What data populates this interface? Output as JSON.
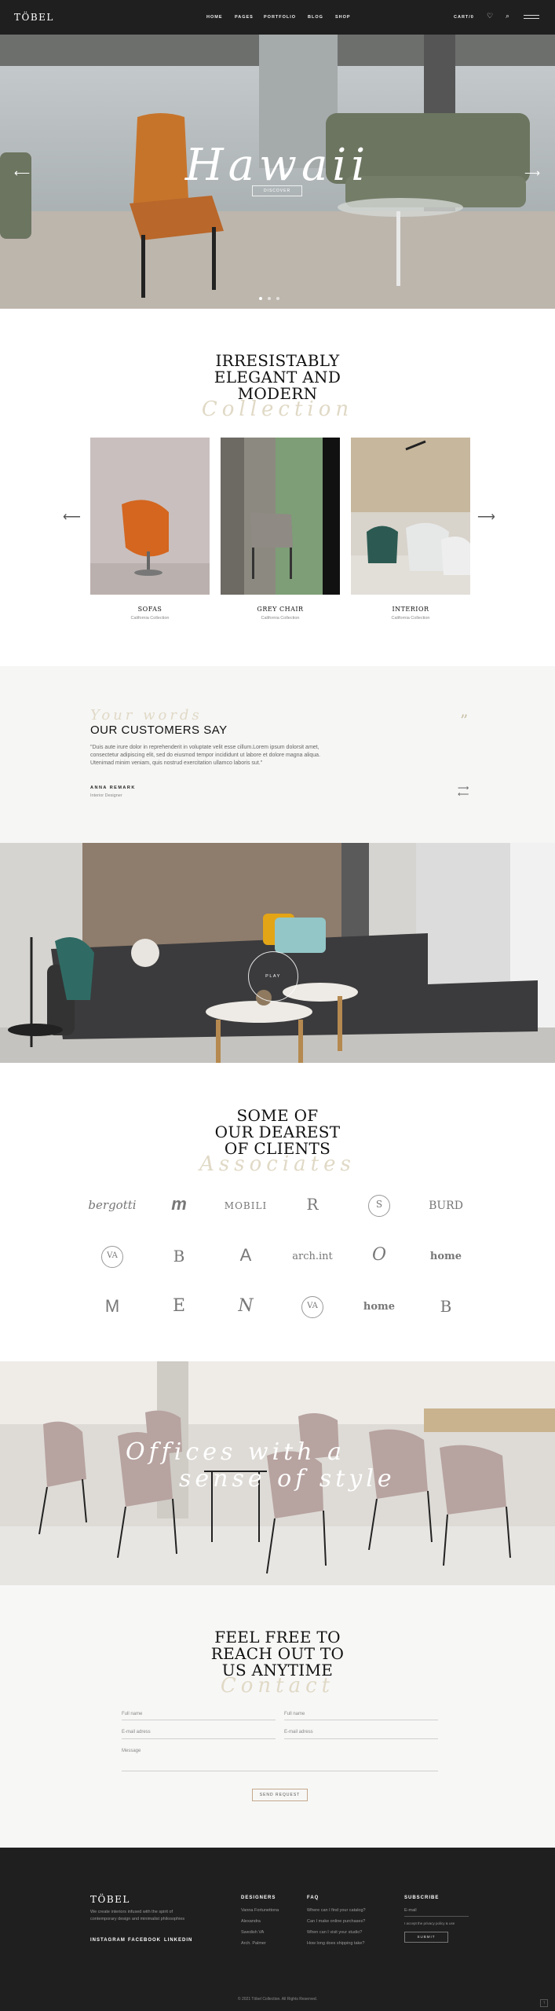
{
  "header": {
    "logo": "TÖBEL",
    "nav": [
      "HOME",
      "PAGES",
      "PORTFOLIO",
      "BLOG",
      "SHOP"
    ],
    "cart_label": "CART/0"
  },
  "hero": {
    "script_title": "Hawaii",
    "button_label": "DISCOVER"
  },
  "collection": {
    "title_lines": [
      "IRRESISTABLY",
      "ELEGANT AND",
      "MODERN"
    ],
    "script_sub": "Collection",
    "products": [
      {
        "name": "SOFAS",
        "sub": "California Collection"
      },
      {
        "name": "GREY CHAIR",
        "sub": "California Collection"
      },
      {
        "name": "INTERIOR",
        "sub": "California Collection"
      }
    ]
  },
  "testimonial": {
    "script_sub": "Your words",
    "title": "OUR CUSTOMERS SAY",
    "quote_line1": "\"Duis aute irure dolor in reprehenderit in voluptate velit esse cillum.Lorem ipsum dolorsit amet,",
    "quote_line2": "consectetur adipiscing elit, sed do eiusmod tempor incididunt ut labore et dolore magna aliqua.",
    "quote_line3": "Utenimad minim veniam, quis nostrud exercitation ullamco laboris sut.\"",
    "author": "ANNA REMARK",
    "role": "Interior Designer"
  },
  "video": {
    "play_label": "PLAY"
  },
  "clients": {
    "title_lines": [
      "SOME OF",
      "OUR DEAREST",
      "OF CLIENTS"
    ],
    "script_sub": "Associates",
    "logos": [
      "bergotti",
      "m",
      "MOBILI",
      "R",
      "S",
      "BURD",
      "VA",
      "B",
      "A",
      "arch.int",
      "O",
      "home",
      "M",
      "E",
      "N",
      "VA",
      "home",
      "B"
    ]
  },
  "offices": {
    "line1": "Offices with a",
    "line2": "sense of style"
  },
  "contact": {
    "title_lines": [
      "FEEL FREE TO",
      "REACH OUT TO",
      "US ANYTIME"
    ],
    "script_sub": "Contact",
    "fullname1": "Full name",
    "fullname2": "Full name",
    "email1": "E-mail adress",
    "email2": "E-mail adress",
    "message": "Message",
    "send_label": "SEND REQUEST"
  },
  "footer": {
    "logo": "TÖBEL",
    "desc_line1": "We create interiors infused with the spirit of",
    "desc_line2": "contemporary design and minimalist philosophies",
    "socials": [
      "INSTAGRAM",
      "FACEBOOK",
      "LINKEDIN"
    ],
    "designers_head": "DESIGNERS",
    "designers": [
      "Vanna Fortunettona",
      "Alexandra",
      "Swedish VA",
      "Arch. Palmer"
    ],
    "faq_head": "FAQ",
    "faq": [
      "Where can I find your catalog?",
      "Can I make online purchases?",
      "When can I visit your studio?",
      "How long does shipping take?"
    ],
    "subscribe_head": "SUBSCRIBE",
    "email_placeholder": "E-mail",
    "consent": "I accept the privacy policy & use",
    "submit_label": "SUBMIT",
    "copyright": "© 2021 Töbel Collection. All Rights Reserved."
  }
}
